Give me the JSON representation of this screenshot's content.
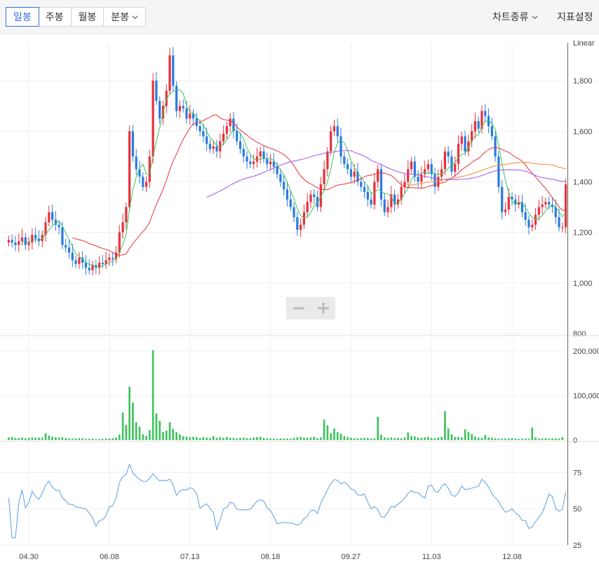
{
  "toolbar": {
    "periods": [
      "일봉",
      "주봉",
      "월봉",
      "분봉"
    ],
    "active_period": "일봉",
    "chart_type_label": "차트종류",
    "indicator_label": "지표설정",
    "icons": [
      "chevron-down-icon",
      "zoom-out-icon",
      "zoom-in-icon"
    ]
  },
  "chart_data": [
    {
      "type": "candlestick",
      "scale_label": "Linear",
      "ylim": [
        800,
        1950
      ],
      "yticks": [
        800,
        1000,
        1200,
        1400,
        1600,
        1800
      ],
      "xticks": [
        "04.30",
        "06.08",
        "07.13",
        "08.18",
        "09.27",
        "11.03",
        "12.08"
      ],
      "colors": {
        "up": "#e8323c",
        "down": "#2b7be0",
        "ma5": "#3cc45a",
        "ma20": "#e8323c",
        "ma60": "#a64ff0",
        "ma120": "#f08a2a"
      },
      "close": [
        1170,
        1160,
        1150,
        1165,
        1180,
        1150,
        1160,
        1190,
        1175,
        1165,
        1190,
        1240,
        1280,
        1250,
        1230,
        1220,
        1150,
        1140,
        1120,
        1090,
        1075,
        1100,
        1080,
        1060,
        1050,
        1070,
        1060,
        1080,
        1075,
        1090,
        1100,
        1095,
        1120,
        1200,
        1240,
        1300,
        1600,
        1500,
        1450,
        1420,
        1380,
        1400,
        1500,
        1800,
        1720,
        1650,
        1700,
        1760,
        1900,
        1780,
        1680,
        1700,
        1690,
        1650,
        1670,
        1650,
        1620,
        1600,
        1580,
        1550,
        1530,
        1540,
        1520,
        1560,
        1590,
        1620,
        1650,
        1600,
        1560,
        1530,
        1500,
        1480,
        1470,
        1480,
        1500,
        1520,
        1490,
        1470,
        1480,
        1460,
        1430,
        1400,
        1370,
        1330,
        1300,
        1260,
        1210,
        1230,
        1280,
        1320,
        1350,
        1340,
        1300,
        1390,
        1450,
        1520,
        1600,
        1620,
        1580,
        1500,
        1470,
        1450,
        1420,
        1440,
        1400,
        1380,
        1360,
        1330,
        1310,
        1400,
        1450,
        1330,
        1280,
        1300,
        1350,
        1310,
        1330,
        1380,
        1400,
        1450,
        1480,
        1420,
        1400,
        1430,
        1450,
        1470,
        1430,
        1380,
        1420,
        1450,
        1520,
        1500,
        1440,
        1470,
        1550,
        1580,
        1520,
        1560,
        1600,
        1640,
        1610,
        1680,
        1660,
        1620,
        1580,
        1500,
        1380,
        1280,
        1290,
        1340,
        1330,
        1310,
        1320,
        1280,
        1250,
        1220,
        1230,
        1270,
        1300,
        1310,
        1320,
        1310,
        1300,
        1260,
        1220,
        1220,
        1390
      ],
      "volume": [
        6000,
        6500,
        4500,
        4200,
        5500,
        4000,
        4800,
        6000,
        5200,
        5500,
        5200,
        15000,
        10000,
        7500,
        6200,
        5300,
        6200,
        4400,
        3500,
        3000,
        3800,
        4200,
        3500,
        2600,
        2800,
        3000,
        2100,
        2300,
        2600,
        3300,
        3500,
        3800,
        5200,
        12000,
        62000,
        34000,
        120000,
        84000,
        40000,
        30000,
        13000,
        9500,
        22000,
        202000,
        60000,
        43000,
        18000,
        21000,
        40000,
        25000,
        18000,
        13000,
        8800,
        7500,
        6200,
        7000,
        6600,
        4200,
        6000,
        5500,
        4500,
        8400,
        5100,
        6000,
        4800,
        6900,
        5000,
        4500,
        3500,
        4800,
        5400,
        4300,
        3800,
        5500,
        6600,
        7000,
        4600,
        3700,
        3900,
        3000,
        2600,
        3300,
        3200,
        3200,
        2900,
        4800,
        6200,
        6900,
        5100,
        4800,
        5800,
        7300,
        4200,
        5600,
        46000,
        33000,
        15000,
        26000,
        18000,
        14000,
        8900,
        6400,
        5000,
        3500,
        4000,
        4300,
        5000,
        4800,
        3700,
        4000,
        52000,
        12000,
        5800,
        4800,
        5800,
        4500,
        4500,
        4000,
        5500,
        17000,
        8900,
        7700,
        5500,
        4400,
        6000,
        7100,
        4900,
        4100,
        5600,
        7000,
        65000,
        26000,
        12500,
        6800,
        7300,
        6000,
        24000,
        18000,
        13000,
        7700,
        5500,
        4700,
        11000,
        5900,
        4800,
        3700,
        3100,
        2800,
        3400,
        3700,
        4400,
        3500,
        2600,
        3000,
        2900,
        2700,
        28000,
        5600,
        3300,
        3400,
        4100,
        3400,
        3800,
        3600,
        3100,
        6600
      ],
      "volume_yticks": [
        0,
        100000,
        200000
      ],
      "volume_ylim": [
        0,
        230000
      ],
      "oscillator_yticks": [
        25,
        50,
        75
      ],
      "oscillator_ylim": [
        25,
        95
      ]
    }
  ]
}
